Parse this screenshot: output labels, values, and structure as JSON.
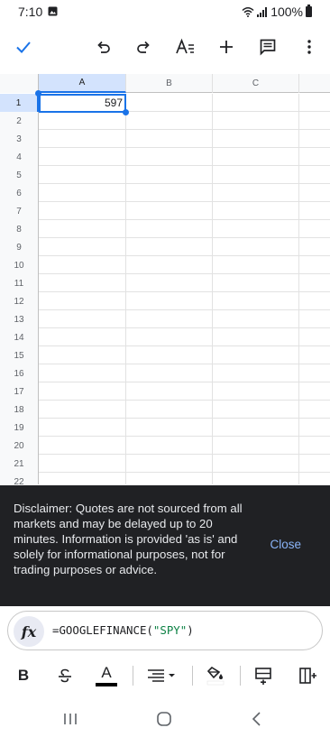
{
  "status_bar": {
    "time": "7:10",
    "battery": "100%"
  },
  "toolbar": {
    "icons": [
      "checkmark-icon",
      "undo-icon",
      "redo-icon",
      "text-format-icon",
      "insert-icon",
      "comment-icon",
      "more-vert-icon"
    ]
  },
  "sheet": {
    "columns": [
      "A",
      "B",
      "C"
    ],
    "rows": [
      "1",
      "2",
      "3",
      "4",
      "5",
      "6",
      "7",
      "8",
      "9",
      "10",
      "11",
      "12",
      "13",
      "14",
      "15",
      "16",
      "17",
      "18",
      "19",
      "20",
      "21",
      "22"
    ],
    "selected_cell": "A1",
    "cell_A1": "597",
    "selection_color": "#1a73e8"
  },
  "snackbar": {
    "message": "Disclaimer: Quotes are not sourced from all markets and may be delayed up to 20 minutes. Information is provided 'as is' and solely for informational purposes, not for trading purposes or advice.",
    "action": "Close"
  },
  "formula_bar": {
    "fx_label": "fx",
    "formula_prefix": "=GOOGLEFINANCE(",
    "formula_arg": "\"SPY\"",
    "formula_suffix": ")"
  },
  "format_bar": {
    "bold_label": "B",
    "text_color_label": "A"
  }
}
